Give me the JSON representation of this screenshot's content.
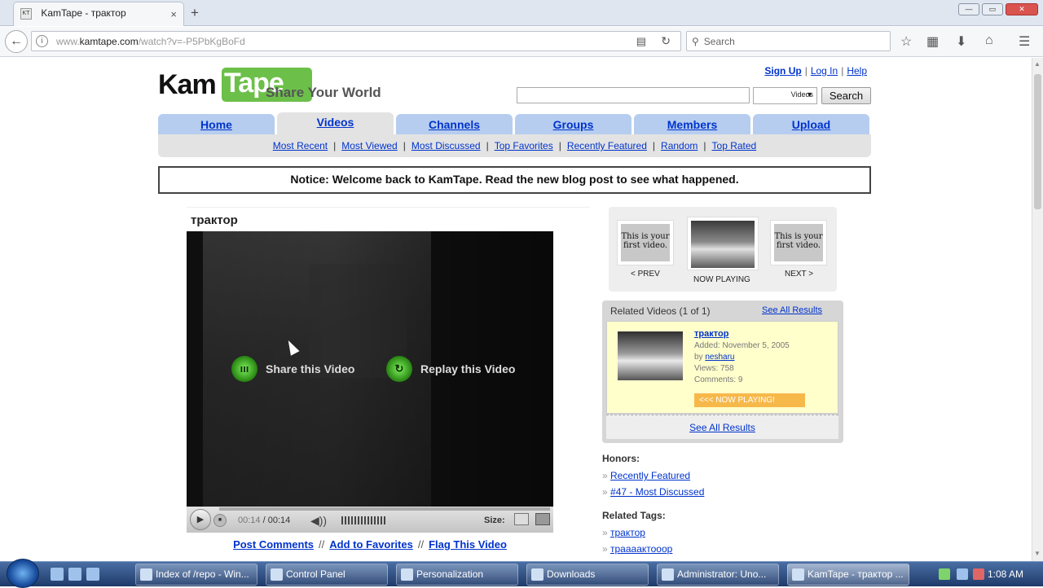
{
  "browser": {
    "tab_title": "KamTape - трактор",
    "favicon_text": "KT",
    "close_glyph": "×",
    "newtab_glyph": "+",
    "url_prefix": "www.",
    "url_domain": "kamtape.com",
    "url_path": "/watch?v=-P5PbKgBoFd",
    "search_placeholder": "Search",
    "icons": [
      "star-icon",
      "reading-list-icon",
      "download-icon",
      "home-icon",
      "menu-icon"
    ]
  },
  "site": {
    "logo_kam": "Kam",
    "logo_tape": "Tape",
    "slogan": "Share Your World",
    "toplinks": [
      "Sign Up",
      "Log In",
      "Help"
    ],
    "search_select": "Videos",
    "search_button": "Search",
    "tabs": [
      "Home",
      "Videos",
      "Channels",
      "Groups",
      "Members",
      "Upload"
    ],
    "selected_tab": "Videos",
    "subnav": [
      "Most Recent",
      "Most Viewed",
      "Most Discussed",
      "Top Favorites",
      "Recently Featured",
      "Random",
      "Top Rated"
    ],
    "notice": "Notice: Welcome back to KamTape. Read the new blog post to see what happened."
  },
  "video": {
    "title": "трактор",
    "share_label": "Share this Video",
    "replay_label": "Replay this Video",
    "time_current": "00:14",
    "time_total": "/ 00:14",
    "size_label": "Size:",
    "links": [
      "Post Comments",
      "Add to Favorites",
      "Flag This Video"
    ],
    "separator": "//"
  },
  "navigator": {
    "thumb_text": "This is your first video.",
    "prev": "< PREV",
    "now": "NOW PLAYING",
    "next": "NEXT >"
  },
  "related": {
    "header": "Related Videos (1 of 1)",
    "see_all": "See All Results",
    "item": {
      "title": "трактор",
      "added": "Added: November 5, 2005",
      "by_prefix": "by",
      "by_user": "nesharu",
      "views": "Views: 758",
      "comments": "Comments: 9",
      "badge": "<<< NOW PLAYING!"
    },
    "footer_link": "See All Results"
  },
  "honors": {
    "title": "Honors:",
    "items": [
      "Recently Featured",
      "#47 - Most Discussed"
    ]
  },
  "tags": {
    "title": "Related Tags:",
    "items": [
      "трактор",
      "траааактооор"
    ]
  },
  "taskbar": {
    "buttons": [
      "Index of /repo - Win...",
      "Control Panel",
      "Personalization",
      "Downloads",
      "Administrator: Uno...",
      "KamTape - трактор ..."
    ],
    "clock": "1:08 AM"
  }
}
